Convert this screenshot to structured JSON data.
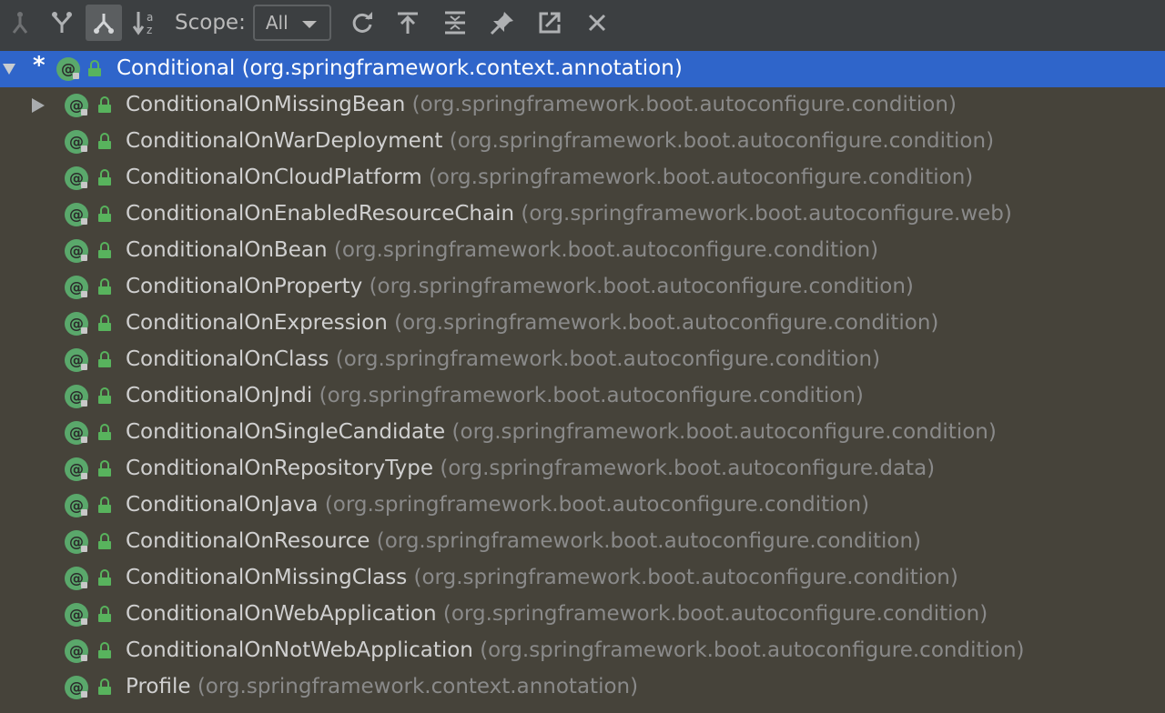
{
  "toolbar": {
    "buttons": [
      {
        "icon": "supertypes-hierarchy-icon"
      },
      {
        "icon": "subtypes-hierarchy-icon"
      },
      {
        "icon": "class-hierarchy-icon"
      },
      {
        "icon": "sort-alphabetically-icon"
      }
    ],
    "scope_label": "Scope:",
    "scope_value": "All",
    "actions": [
      {
        "icon": "refresh-icon"
      },
      {
        "icon": "expand-all-icon"
      },
      {
        "icon": "collapse-all-icon"
      },
      {
        "icon": "pin-icon"
      },
      {
        "icon": "export-icon"
      },
      {
        "icon": "close-icon"
      }
    ]
  },
  "tree": {
    "root": {
      "marker": "*",
      "name": "Conditional",
      "package": "(org.springframework.context.annotation)",
      "expanded": true
    },
    "children": [
      {
        "name": "ConditionalOnMissingBean",
        "package": "(org.springframework.boot.autoconfigure.condition)",
        "expandable": true
      },
      {
        "name": "ConditionalOnWarDeployment",
        "package": "(org.springframework.boot.autoconfigure.condition)"
      },
      {
        "name": "ConditionalOnCloudPlatform",
        "package": "(org.springframework.boot.autoconfigure.condition)"
      },
      {
        "name": "ConditionalOnEnabledResourceChain",
        "package": "(org.springframework.boot.autoconfigure.web)"
      },
      {
        "name": "ConditionalOnBean",
        "package": "(org.springframework.boot.autoconfigure.condition)"
      },
      {
        "name": "ConditionalOnProperty",
        "package": "(org.springframework.boot.autoconfigure.condition)"
      },
      {
        "name": "ConditionalOnExpression",
        "package": "(org.springframework.boot.autoconfigure.condition)"
      },
      {
        "name": "ConditionalOnClass",
        "package": "(org.springframework.boot.autoconfigure.condition)"
      },
      {
        "name": "ConditionalOnJndi",
        "package": "(org.springframework.boot.autoconfigure.condition)"
      },
      {
        "name": "ConditionalOnSingleCandidate",
        "package": "(org.springframework.boot.autoconfigure.condition)"
      },
      {
        "name": "ConditionalOnRepositoryType",
        "package": "(org.springframework.boot.autoconfigure.data)"
      },
      {
        "name": "ConditionalOnJava",
        "package": "(org.springframework.boot.autoconfigure.condition)"
      },
      {
        "name": "ConditionalOnResource",
        "package": "(org.springframework.boot.autoconfigure.condition)"
      },
      {
        "name": "ConditionalOnMissingClass",
        "package": "(org.springframework.boot.autoconfigure.condition)"
      },
      {
        "name": "ConditionalOnWebApplication",
        "package": "(org.springframework.boot.autoconfigure.condition)"
      },
      {
        "name": "ConditionalOnNotWebApplication",
        "package": "(org.springframework.boot.autoconfigure.condition)"
      },
      {
        "name": "Profile",
        "package": "(org.springframework.context.annotation)"
      }
    ]
  },
  "colors": {
    "background": "#46433a",
    "toolbar": "#3c3f41",
    "selection": "#2f65ca",
    "annotation_icon": "#5aa86b",
    "name_text": "#d0d0d0",
    "package_text": "#8a8a8a"
  }
}
